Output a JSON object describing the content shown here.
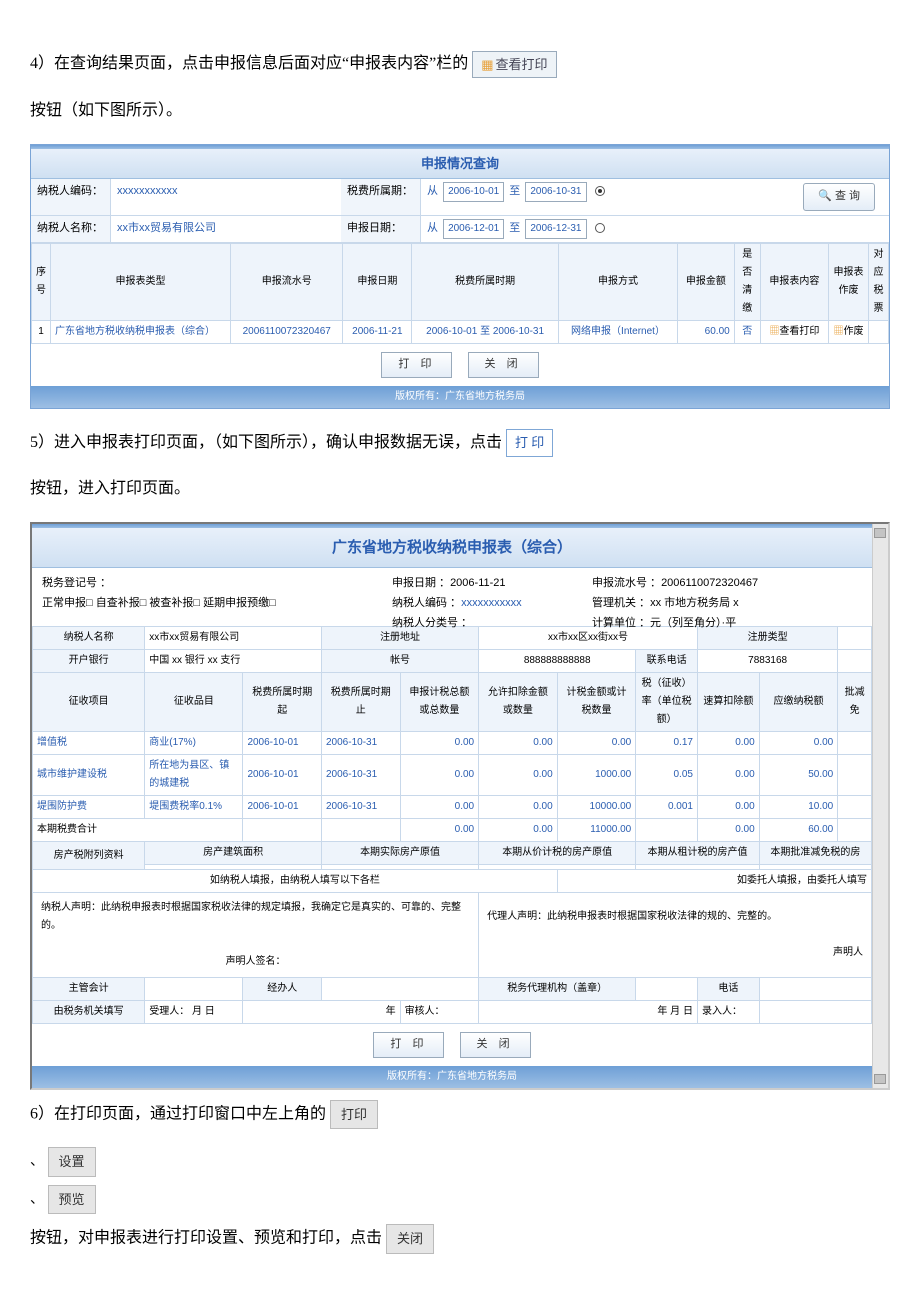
{
  "para4_pre": "4）在查询结果页面，点击申报信息后面对应“申报表内容”栏的",
  "para4_btn": "查看打印",
  "para4_post": "按钮（如下图所示）。",
  "shot1": {
    "title": "申报情况查询",
    "row1_lbl1": "纳税人编码：",
    "row1_val1": "xxxxxxxxxxx",
    "row1_lbl2": "税费所属期：",
    "row1_from": "从",
    "row1_d1": "2006-10-01",
    "row1_to": "至",
    "row1_d2": "2006-10-31",
    "row2_lbl1": "纳税人名称：",
    "row2_val1": "xx市xx贸易有限公司",
    "row2_lbl2": "申报日期：",
    "row2_d1": "2006-12-01",
    "row2_d2": "2006-12-31",
    "searchbtn": "查 询",
    "th_seq": "序号",
    "th_type": "申报表类型",
    "th_flow": "申报流水号",
    "th_date": "申报日期",
    "th_period": "税费所属时期",
    "th_way": "申报方式",
    "th_amt": "申报金额",
    "th_clear": "是否清缴",
    "th_content": "申报表内容",
    "th_void": "申报表作废",
    "th_match": "对应税票",
    "td_seq": "1",
    "td_type": "广东省地方税收纳税申报表（综合）",
    "td_flow": "2006110072320467",
    "td_date": "2006-11-21",
    "td_period": "2006-10-01 至 2006-10-31",
    "td_way": "网络申报（Internet）",
    "td_amt": "60.00",
    "td_clear": "否",
    "td_content": "查看打印",
    "td_void": "作废",
    "btn_print": "打 印",
    "btn_close": "关 闭",
    "copyright": "版权所有：广东省地方税务局"
  },
  "para5_pre": "5）进入申报表打印页面，（如下图所示），确认申报数据无误，点击",
  "para5_btn": "打 印",
  "para5_post": "按钮，进入打印页面。",
  "shot2": {
    "title": "广东省地方税收纳税申报表（综合）",
    "hdr_date_lbl": "申报日期 ：",
    "hdr_date_val": "2006-11-21",
    "hdr_flow_lbl": "申报流水号 ：",
    "hdr_flow_val": "2006110072320467",
    "hdr_reg_lbl": "税务登记号 ：",
    "hdr_payercode_lbl": "纳税人编码 ：",
    "hdr_payercode_val": "xxxxxxxxxxx",
    "hdr_org_lbl": "管理机关 ：",
    "hdr_org_val": "xx 市地方税务局 x",
    "hdr_check": "正常申报□  自查补报□  被查补报□  延期申报预缴□",
    "hdr_class_lbl": "纳税人分类号 ：",
    "hdr_unit_lbl": "计算单位 ：元（列至角分）·平",
    "r1_c1": "纳税人名称",
    "r1_c2": "xx市xx贸易有限公司",
    "r1_c3": "注册地址",
    "r1_c4": "xx市xx区xx街xx号",
    "r1_c5": "注册类型",
    "r2_c1": "开户银行",
    "r2_c2": "中国 xx 银行 xx 支行",
    "r2_c3": "帐号",
    "r2_c4": "888888888888",
    "r2_c5": "联系电话",
    "r2_c6": "7883168",
    "th2_1": "征收项目",
    "th2_2": "征收品目",
    "th2_3": "税费所属时期起",
    "th2_4": "税费所属时期止",
    "th2_5": "申报计税总额或总数量",
    "th2_6": "允许扣除金额或数量",
    "th2_7": "计税金额或计税数量",
    "th2_8": "税（征收）率（单位税额）",
    "th2_9": "速算扣除额",
    "th2_10": "应缴纳税额",
    "th2_11": "批减免",
    "rows": [
      {
        "c1": "增值税",
        "c2": "商业(17%)",
        "c3": "2006-10-01",
        "c4": "2006-10-31",
        "c5": "0.00",
        "c6": "0.00",
        "c7": "0.00",
        "c8": "0.17",
        "c9": "0.00",
        "c10": "0.00"
      },
      {
        "c1": "城市维护建设税",
        "c2": "所在地为县区、镇的城建税",
        "c3": "2006-10-01",
        "c4": "2006-10-31",
        "c5": "0.00",
        "c6": "0.00",
        "c7": "1000.00",
        "c8": "0.05",
        "c9": "0.00",
        "c10": "50.00"
      },
      {
        "c1": "堤围防护费",
        "c2": "堤围费税率0.1%",
        "c3": "2006-10-01",
        "c4": "2006-10-31",
        "c5": "0.00",
        "c6": "0.00",
        "c7": "10000.00",
        "c8": "0.001",
        "c9": "0.00",
        "c10": "10.00"
      }
    ],
    "sum_lbl": "本期税费合计",
    "sum_c5": "0.00",
    "sum_c6": "0.00",
    "sum_c7": "11000.00",
    "sum_c9": "0.00",
    "sum_c10": "60.00",
    "fc_lbl": "房产税附列资料",
    "fc_c1": "房产建筑面积",
    "fc_c2": "本期实际房产原值",
    "fc_c3": "本期从价计税的房产原值",
    "fc_c4": "本期从租计税的房产值",
    "fc_c5": "本期批准减免税的房",
    "note_left": "如纳税人填报，由纳税人填写以下各栏",
    "note_right": "如委托人填报，由委托人填写",
    "decl_left": "纳税人声明：此纳税申报表时根据国家税收法律的规定填报，我确定它是真实的、可靠的、完整的。",
    "decl_sign": "声明人签名：",
    "decl_right": "代理人声明：此纳税申报表时根据国家税收法律的规的、完整的。",
    "decl_right_sign": "声明人",
    "row_acc": "主管会计",
    "row_op": "经办人",
    "row_agent": "税务代理机构（盖章）",
    "row_tel": "电话",
    "row_fill": "由税务机关填写",
    "row_recv": "受理人：    月    日",
    "row_year": "年",
    "row_audit": "审核人：",
    "row_ymd": "年    月    日",
    "row_input": "录入人：",
    "btn_print": "打 印",
    "btn_close": "关 闭",
    "copyright": "版权所有：广东省地方税务局"
  },
  "para6_pre": "6）在打印页面，通过打印窗口中左上角的",
  "btn_print2": "打印",
  "btn_set": "设置",
  "btn_preview": "预览",
  "para6_mid": "按钮，对申报表进行打印设置、预览和打印，点击",
  "btn_close2": "关闭",
  "comma": "、"
}
